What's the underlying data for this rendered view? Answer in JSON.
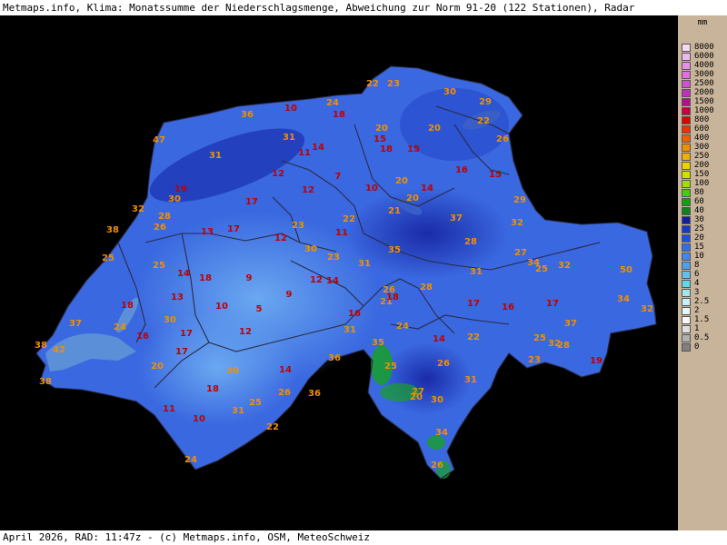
{
  "title": "Metmaps.info, Klima: Monatssumme der Niederschlagsmenge, Abweichung zur Norm 91-20 (122 Stationen), Radar",
  "footer": "April 2026, RAD: 11:47z - (c) Metmaps.info, OSM, MeteoSchweiz",
  "legend": {
    "unit": "mm",
    "items": [
      {
        "label": "8000",
        "color": "#f8d8f8"
      },
      {
        "label": "6000",
        "color": "#f0b8f0"
      },
      {
        "label": "4000",
        "color": "#e890e8"
      },
      {
        "label": "3000",
        "color": "#e070e0"
      },
      {
        "label": "2500",
        "color": "#d050d0"
      },
      {
        "label": "2000",
        "color": "#c030c0"
      },
      {
        "label": "1500",
        "color": "#b01090"
      },
      {
        "label": "1000",
        "color": "#c00040"
      },
      {
        "label": "800",
        "color": "#e00000"
      },
      {
        "label": "600",
        "color": "#f03000"
      },
      {
        "label": "400",
        "color": "#f06000"
      },
      {
        "label": "300",
        "color": "#f09000"
      },
      {
        "label": "250",
        "color": "#f0b000"
      },
      {
        "label": "200",
        "color": "#f0d000"
      },
      {
        "label": "150",
        "color": "#d0e000"
      },
      {
        "label": "100",
        "color": "#a0e000"
      },
      {
        "label": "80",
        "color": "#40d000"
      },
      {
        "label": "60",
        "color": "#10a010"
      },
      {
        "label": "40",
        "color": "#108020"
      },
      {
        "label": "30",
        "color": "#1020a0"
      },
      {
        "label": "25",
        "color": "#1838c8"
      },
      {
        "label": "20",
        "color": "#2050e0"
      },
      {
        "label": "15",
        "color": "#3070e8"
      },
      {
        "label": "10",
        "color": "#4088f0"
      },
      {
        "label": "8",
        "color": "#50a0f0"
      },
      {
        "label": "6",
        "color": "#60c0f0"
      },
      {
        "label": "4",
        "color": "#60d8e8"
      },
      {
        "label": "3",
        "color": "#a0e8f0"
      },
      {
        "label": "2.5",
        "color": "#c8f0f8"
      },
      {
        "label": "2",
        "color": "#e8f8f8"
      },
      {
        "label": "1.5",
        "color": "#f8f8f8"
      },
      {
        "label": "1",
        "color": "#e0e0e0"
      },
      {
        "label": "0.5",
        "color": "#b0b0b0"
      },
      {
        "label": "0",
        "color": "#808080"
      }
    ]
  },
  "stations": [
    {
      "v": "22",
      "c": "o"
    },
    {
      "v": "23",
      "c": "o"
    },
    {
      "v": "30",
      "c": "o"
    },
    {
      "v": "29",
      "c": "o"
    },
    {
      "v": "10",
      "c": "r"
    },
    {
      "v": "24",
      "c": "o"
    },
    {
      "v": "18",
      "c": "r"
    },
    {
      "v": "36",
      "c": "o"
    },
    {
      "v": "22",
      "c": "o"
    },
    {
      "v": "20",
      "c": "o"
    },
    {
      "v": "20",
      "c": "o"
    },
    {
      "v": "15",
      "c": "r"
    },
    {
      "v": "26",
      "c": "o"
    },
    {
      "v": "47",
      "c": "o"
    },
    {
      "v": "31",
      "c": "o"
    },
    {
      "v": "14",
      "c": "r"
    },
    {
      "v": "11",
      "c": "r"
    },
    {
      "v": "18",
      "c": "r"
    },
    {
      "v": "15",
      "c": "r"
    },
    {
      "v": "31",
      "c": "o"
    },
    {
      "v": "16",
      "c": "r"
    },
    {
      "v": "12",
      "c": "r"
    },
    {
      "v": "7",
      "c": "r"
    },
    {
      "v": "15",
      "c": "r"
    },
    {
      "v": "20",
      "c": "o"
    },
    {
      "v": "19",
      "c": "r"
    },
    {
      "v": "12",
      "c": "r"
    },
    {
      "v": "10",
      "c": "r"
    },
    {
      "v": "14",
      "c": "r"
    },
    {
      "v": "30",
      "c": "o"
    },
    {
      "v": "17",
      "c": "r"
    },
    {
      "v": "20",
      "c": "o"
    },
    {
      "v": "29",
      "c": "o"
    },
    {
      "v": "32",
      "c": "o"
    },
    {
      "v": "28",
      "c": "o"
    },
    {
      "v": "21",
      "c": "o"
    },
    {
      "v": "37",
      "c": "o"
    },
    {
      "v": "23",
      "c": "o"
    },
    {
      "v": "22",
      "c": "o"
    },
    {
      "v": "32",
      "c": "o"
    },
    {
      "v": "38",
      "c": "o"
    },
    {
      "v": "26",
      "c": "o"
    },
    {
      "v": "17",
      "c": "r"
    },
    {
      "v": "13",
      "c": "r"
    },
    {
      "v": "12",
      "c": "r"
    },
    {
      "v": "11",
      "c": "r"
    },
    {
      "v": "28",
      "c": "o"
    },
    {
      "v": "30",
      "c": "o"
    },
    {
      "v": "35",
      "c": "o"
    },
    {
      "v": "27",
      "c": "o"
    },
    {
      "v": "25",
      "c": "o"
    },
    {
      "v": "23",
      "c": "o"
    },
    {
      "v": "31",
      "c": "o"
    },
    {
      "v": "34",
      "c": "o"
    },
    {
      "v": "32",
      "c": "o"
    },
    {
      "v": "25",
      "c": "o"
    },
    {
      "v": "25",
      "c": "o"
    },
    {
      "v": "14",
      "c": "r"
    },
    {
      "v": "18",
      "c": "r"
    },
    {
      "v": "9",
      "c": "r"
    },
    {
      "v": "12",
      "c": "r"
    },
    {
      "v": "14",
      "c": "r"
    },
    {
      "v": "31",
      "c": "o"
    },
    {
      "v": "50",
      "c": "o"
    },
    {
      "v": "28",
      "c": "o"
    },
    {
      "v": "26",
      "c": "o"
    },
    {
      "v": "13",
      "c": "r"
    },
    {
      "v": "10",
      "c": "r"
    },
    {
      "v": "5",
      "c": "r"
    },
    {
      "v": "9",
      "c": "r"
    },
    {
      "v": "21",
      "c": "o"
    },
    {
      "v": "18",
      "c": "r"
    },
    {
      "v": "17",
      "c": "r"
    },
    {
      "v": "16",
      "c": "r"
    },
    {
      "v": "17",
      "c": "r"
    },
    {
      "v": "34",
      "c": "o"
    },
    {
      "v": "18",
      "c": "r"
    },
    {
      "v": "30",
      "c": "o"
    },
    {
      "v": "16",
      "c": "r"
    },
    {
      "v": "32",
      "c": "o"
    },
    {
      "v": "37",
      "c": "o"
    },
    {
      "v": "24",
      "c": "o"
    },
    {
      "v": "24",
      "c": "o"
    },
    {
      "v": "17",
      "c": "r"
    },
    {
      "v": "12",
      "c": "r"
    },
    {
      "v": "31",
      "c": "o"
    },
    {
      "v": "35",
      "c": "o"
    },
    {
      "v": "14",
      "c": "r"
    },
    {
      "v": "22",
      "c": "o"
    },
    {
      "v": "37",
      "c": "o"
    },
    {
      "v": "38",
      "c": "o"
    },
    {
      "v": "42",
      "c": "o"
    },
    {
      "v": "16",
      "c": "r"
    },
    {
      "v": "25",
      "c": "o"
    },
    {
      "v": "32",
      "c": "o"
    },
    {
      "v": "28",
      "c": "o"
    },
    {
      "v": "17",
      "c": "r"
    },
    {
      "v": "36",
      "c": "o"
    },
    {
      "v": "23",
      "c": "o"
    },
    {
      "v": "19",
      "c": "r"
    },
    {
      "v": "38",
      "c": "o"
    },
    {
      "v": "20",
      "c": "o"
    },
    {
      "v": "30",
      "c": "o"
    },
    {
      "v": "14",
      "c": "r"
    },
    {
      "v": "25",
      "c": "o"
    },
    {
      "v": "26",
      "c": "o"
    },
    {
      "v": "18",
      "c": "r"
    },
    {
      "v": "26",
      "c": "o"
    },
    {
      "v": "36",
      "c": "o"
    },
    {
      "v": "25",
      "c": "o"
    },
    {
      "v": "27",
      "c": "o"
    },
    {
      "v": "31",
      "c": "o"
    },
    {
      "v": "11",
      "c": "r"
    },
    {
      "v": "31",
      "c": "o"
    },
    {
      "v": "20",
      "c": "o"
    },
    {
      "v": "30",
      "c": "o"
    },
    {
      "v": "10",
      "c": "r"
    },
    {
      "v": "22",
      "c": "o"
    },
    {
      "v": "34",
      "c": "o"
    },
    {
      "v": "24",
      "c": "o"
    },
    {
      "v": "26",
      "c": "o"
    }
  ],
  "colors": {
    "orange_label": "#f09000",
    "red_label": "#c00000",
    "map_background": "#000000",
    "legend_background": "#c8b49a"
  }
}
